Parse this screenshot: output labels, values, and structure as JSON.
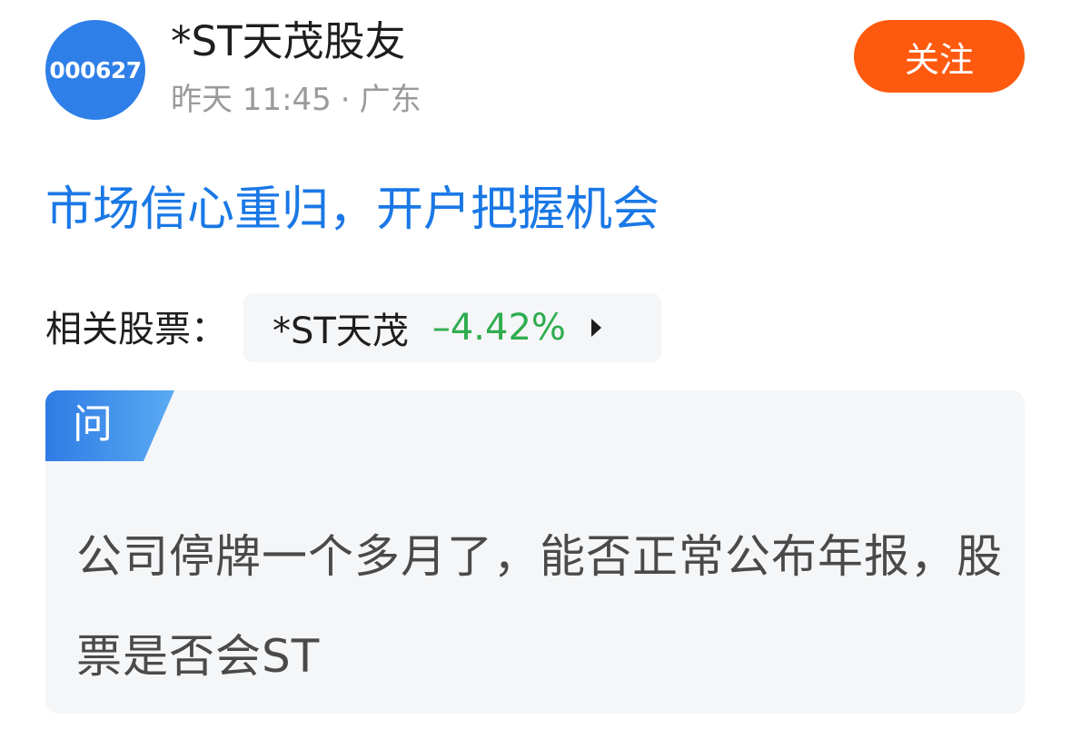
{
  "author": {
    "avatar_text": "000627",
    "name": "*ST天茂股友",
    "time": "昨天 11:45",
    "separator": "·",
    "location": "广东"
  },
  "follow_button": {
    "label": "关注",
    "color": "#fe5a0f"
  },
  "post": {
    "title": "市场信心重归，开户把握机会",
    "title_color": "#1a78e6"
  },
  "related": {
    "label": "相关股票：",
    "stock_name": "*ST天茂",
    "change": "–4.42%",
    "change_color": "#2fad4f",
    "arrow_icon": "triangle-right-icon"
  },
  "question": {
    "tag": "问",
    "text": "公司停牌一个多月了，能否正常公布年报，股票是否会ST",
    "tag_color": "#2f7fe8"
  }
}
